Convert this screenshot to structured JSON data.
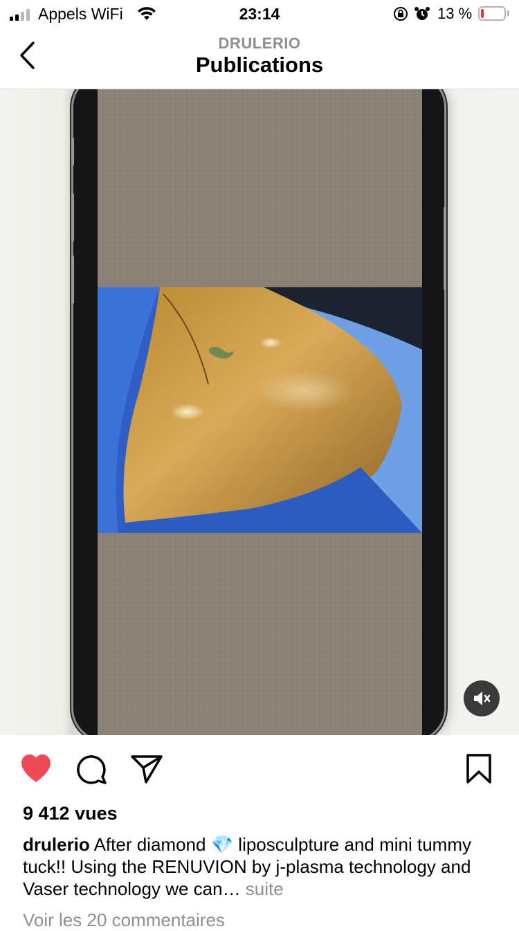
{
  "status_bar": {
    "carrier": "Appels WiFi",
    "time": "23:14",
    "battery_percent": "13 %",
    "battery_level": 0.13,
    "signal_bars": 2
  },
  "header": {
    "subtitle": "DRULERIO",
    "title": "Publications"
  },
  "post": {
    "views": "9 412 vues",
    "caption_user": "drulerio",
    "caption_text_1": " After diamond ",
    "caption_emoji": "💎",
    "caption_text_2": " liposculpture and mini tummy tuck!! Using the RENUVION by j-plasma technology and Vaser technology we can…",
    "caption_more": " suite",
    "comments_link": "Voir les 20 commentaires",
    "liked": true
  },
  "icons": {
    "back": "chevron-left-icon",
    "like": "heart-icon",
    "comment": "comment-icon",
    "share": "send-icon",
    "save": "bookmark-icon",
    "mute": "speaker-muted-icon"
  },
  "colors": {
    "like": "#ed4956",
    "muted_text": "#8e8e8e",
    "battery_low": "#e9362b"
  }
}
